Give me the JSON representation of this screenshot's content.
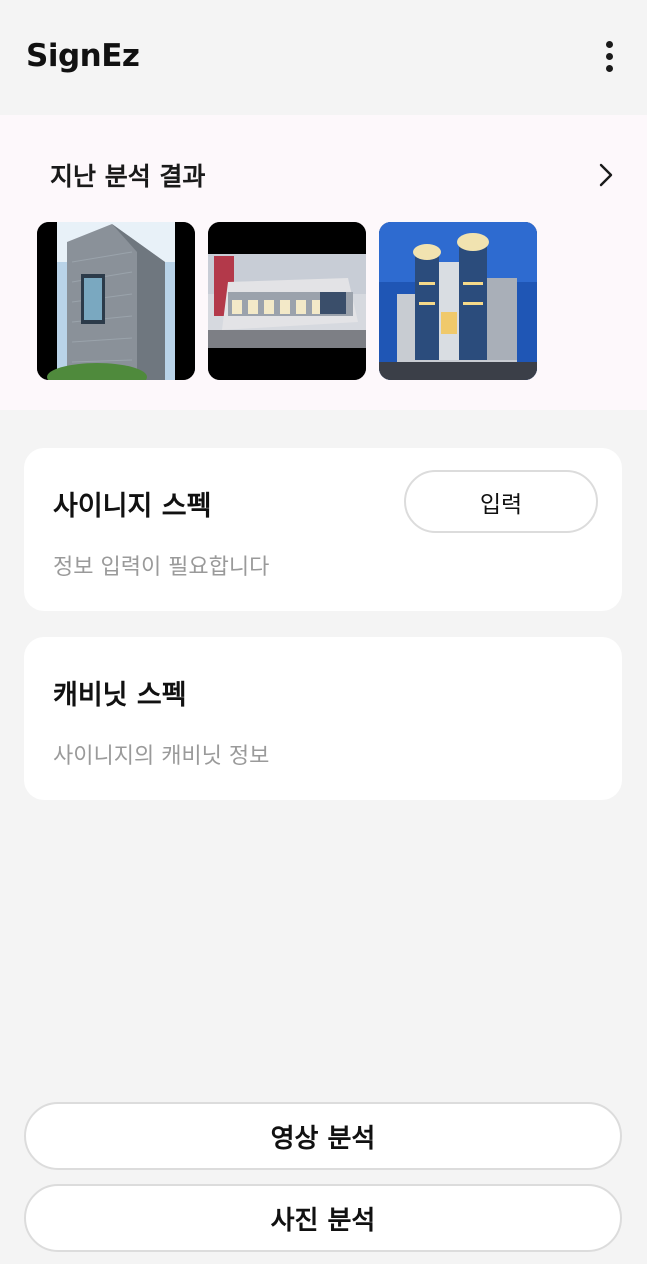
{
  "appbar": {
    "title": "SignEz",
    "menu_icon": "more-vertical-icon"
  },
  "history": {
    "title": "지난 분석 결과",
    "more_icon": "chevron-right-icon",
    "thumbnails": [
      {
        "name": "tower-building-with-billboard"
      },
      {
        "name": "shopping-mall-rendering"
      },
      {
        "name": "department-store-night"
      }
    ]
  },
  "signage_card": {
    "title": "사이니지 스펙",
    "subtitle": "정보 입력이 필요합니다",
    "button_label": "입력"
  },
  "cabinet_card": {
    "title": "캐비닛 스펙",
    "subtitle": "사이니지의 캐비닛 정보"
  },
  "actions": {
    "video_label": "영상 분석",
    "photo_label": "사진 분석"
  },
  "colors": {
    "background": "#f4f4f4",
    "history_bg": "#fdf8fb",
    "card_bg": "#ffffff",
    "muted_text": "#9a9a9a",
    "border": "#dcdcdc"
  }
}
